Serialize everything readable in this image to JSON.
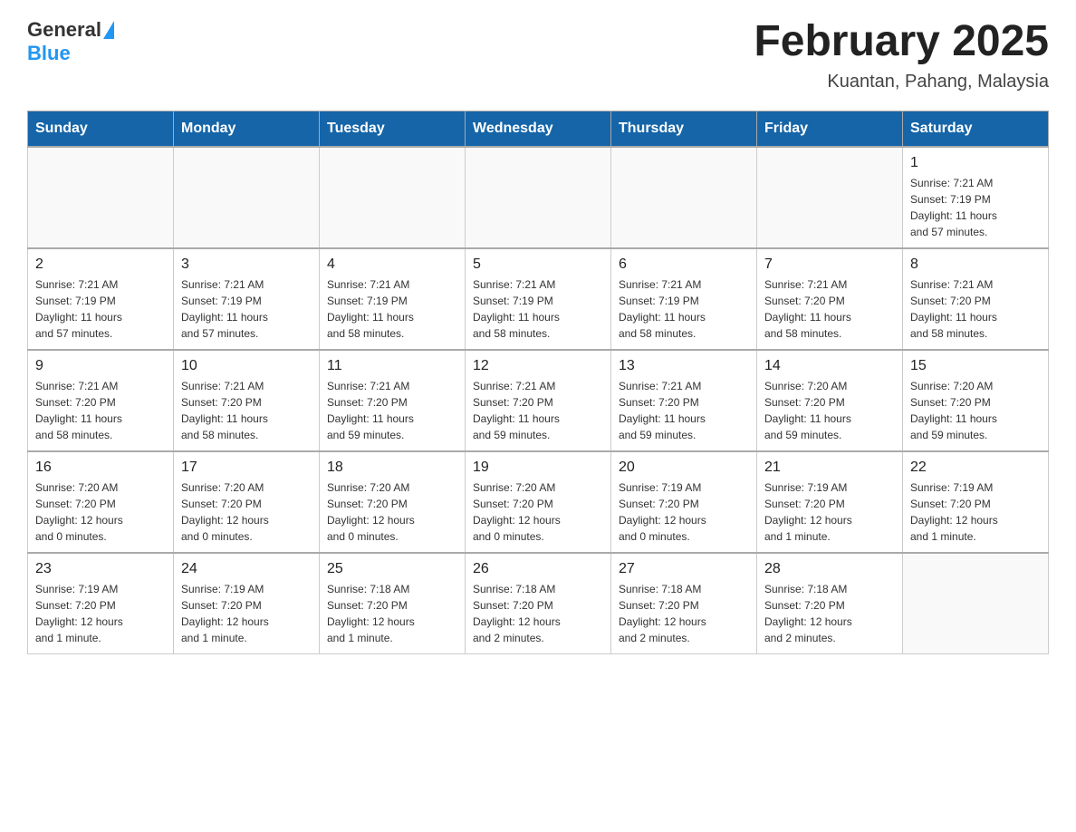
{
  "header": {
    "logo_general": "General",
    "logo_blue": "Blue",
    "title": "February 2025",
    "subtitle": "Kuantan, Pahang, Malaysia"
  },
  "days_of_week": [
    "Sunday",
    "Monday",
    "Tuesday",
    "Wednesday",
    "Thursday",
    "Friday",
    "Saturday"
  ],
  "weeks": [
    [
      {
        "day": "",
        "info": ""
      },
      {
        "day": "",
        "info": ""
      },
      {
        "day": "",
        "info": ""
      },
      {
        "day": "",
        "info": ""
      },
      {
        "day": "",
        "info": ""
      },
      {
        "day": "",
        "info": ""
      },
      {
        "day": "1",
        "info": "Sunrise: 7:21 AM\nSunset: 7:19 PM\nDaylight: 11 hours\nand 57 minutes."
      }
    ],
    [
      {
        "day": "2",
        "info": "Sunrise: 7:21 AM\nSunset: 7:19 PM\nDaylight: 11 hours\nand 57 minutes."
      },
      {
        "day": "3",
        "info": "Sunrise: 7:21 AM\nSunset: 7:19 PM\nDaylight: 11 hours\nand 57 minutes."
      },
      {
        "day": "4",
        "info": "Sunrise: 7:21 AM\nSunset: 7:19 PM\nDaylight: 11 hours\nand 58 minutes."
      },
      {
        "day": "5",
        "info": "Sunrise: 7:21 AM\nSunset: 7:19 PM\nDaylight: 11 hours\nand 58 minutes."
      },
      {
        "day": "6",
        "info": "Sunrise: 7:21 AM\nSunset: 7:19 PM\nDaylight: 11 hours\nand 58 minutes."
      },
      {
        "day": "7",
        "info": "Sunrise: 7:21 AM\nSunset: 7:20 PM\nDaylight: 11 hours\nand 58 minutes."
      },
      {
        "day": "8",
        "info": "Sunrise: 7:21 AM\nSunset: 7:20 PM\nDaylight: 11 hours\nand 58 minutes."
      }
    ],
    [
      {
        "day": "9",
        "info": "Sunrise: 7:21 AM\nSunset: 7:20 PM\nDaylight: 11 hours\nand 58 minutes."
      },
      {
        "day": "10",
        "info": "Sunrise: 7:21 AM\nSunset: 7:20 PM\nDaylight: 11 hours\nand 58 minutes."
      },
      {
        "day": "11",
        "info": "Sunrise: 7:21 AM\nSunset: 7:20 PM\nDaylight: 11 hours\nand 59 minutes."
      },
      {
        "day": "12",
        "info": "Sunrise: 7:21 AM\nSunset: 7:20 PM\nDaylight: 11 hours\nand 59 minutes."
      },
      {
        "day": "13",
        "info": "Sunrise: 7:21 AM\nSunset: 7:20 PM\nDaylight: 11 hours\nand 59 minutes."
      },
      {
        "day": "14",
        "info": "Sunrise: 7:20 AM\nSunset: 7:20 PM\nDaylight: 11 hours\nand 59 minutes."
      },
      {
        "day": "15",
        "info": "Sunrise: 7:20 AM\nSunset: 7:20 PM\nDaylight: 11 hours\nand 59 minutes."
      }
    ],
    [
      {
        "day": "16",
        "info": "Sunrise: 7:20 AM\nSunset: 7:20 PM\nDaylight: 12 hours\nand 0 minutes."
      },
      {
        "day": "17",
        "info": "Sunrise: 7:20 AM\nSunset: 7:20 PM\nDaylight: 12 hours\nand 0 minutes."
      },
      {
        "day": "18",
        "info": "Sunrise: 7:20 AM\nSunset: 7:20 PM\nDaylight: 12 hours\nand 0 minutes."
      },
      {
        "day": "19",
        "info": "Sunrise: 7:20 AM\nSunset: 7:20 PM\nDaylight: 12 hours\nand 0 minutes."
      },
      {
        "day": "20",
        "info": "Sunrise: 7:19 AM\nSunset: 7:20 PM\nDaylight: 12 hours\nand 0 minutes."
      },
      {
        "day": "21",
        "info": "Sunrise: 7:19 AM\nSunset: 7:20 PM\nDaylight: 12 hours\nand 1 minute."
      },
      {
        "day": "22",
        "info": "Sunrise: 7:19 AM\nSunset: 7:20 PM\nDaylight: 12 hours\nand 1 minute."
      }
    ],
    [
      {
        "day": "23",
        "info": "Sunrise: 7:19 AM\nSunset: 7:20 PM\nDaylight: 12 hours\nand 1 minute."
      },
      {
        "day": "24",
        "info": "Sunrise: 7:19 AM\nSunset: 7:20 PM\nDaylight: 12 hours\nand 1 minute."
      },
      {
        "day": "25",
        "info": "Sunrise: 7:18 AM\nSunset: 7:20 PM\nDaylight: 12 hours\nand 1 minute."
      },
      {
        "day": "26",
        "info": "Sunrise: 7:18 AM\nSunset: 7:20 PM\nDaylight: 12 hours\nand 2 minutes."
      },
      {
        "day": "27",
        "info": "Sunrise: 7:18 AM\nSunset: 7:20 PM\nDaylight: 12 hours\nand 2 minutes."
      },
      {
        "day": "28",
        "info": "Sunrise: 7:18 AM\nSunset: 7:20 PM\nDaylight: 12 hours\nand 2 minutes."
      },
      {
        "day": "",
        "info": ""
      }
    ]
  ]
}
